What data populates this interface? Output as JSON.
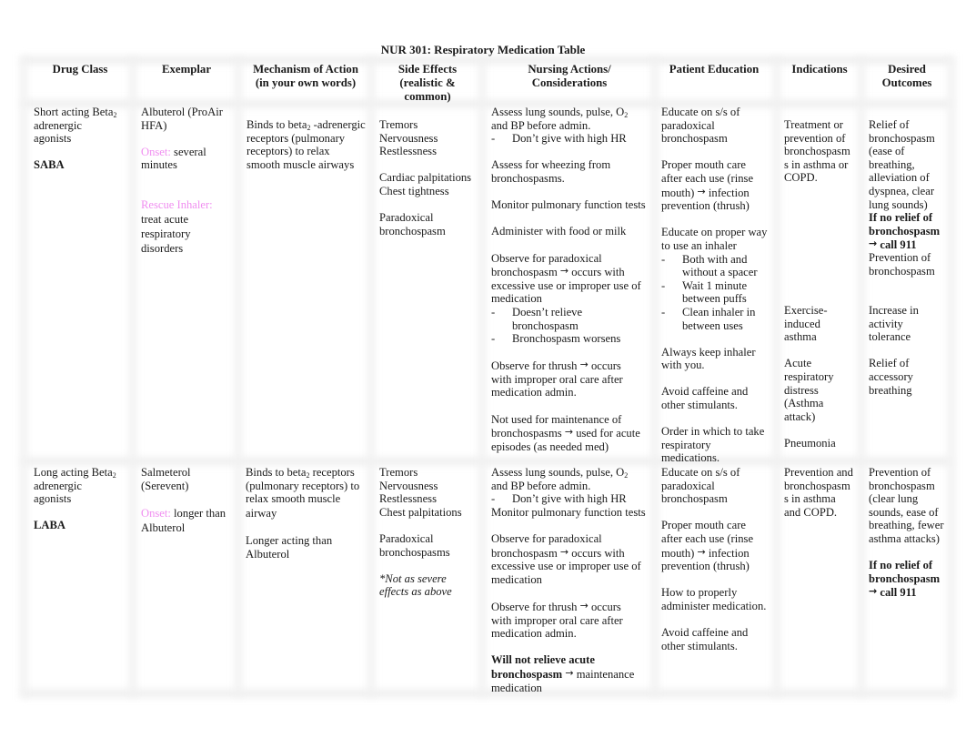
{
  "title": "NUR 301: Respiratory Medication Table",
  "headers": [
    "Drug Class",
    "Exemplar",
    "Mechanism of Action (in your own words)",
    "Side Effects (realistic & common)",
    "Nursing Actions/ Considerations",
    "Patient Education",
    "Indications",
    "Desired Outcomes"
  ],
  "header_lines": {
    "mechanism": [
      "Mechanism of Action",
      "(in your own words)"
    ],
    "side_effects": [
      "Side Effects",
      "(realistic &",
      "common)"
    ],
    "nursing": [
      "Nursing Actions/",
      "Considerations"
    ],
    "desired": [
      "Desired",
      "Outcomes"
    ]
  },
  "arrow_icon": "→",
  "colors": {
    "label_accent": "#f08ef0"
  },
  "rows": {
    "saba": {
      "drug_class": "Short acting Beta2 adrenergic agonists",
      "drug_class_lines": [
        "Short acting Beta",
        "adrenergic",
        "agonists"
      ],
      "abbrev": "SABA",
      "exemplar_lines": [
        "Albuterol (ProAir",
        "HFA)"
      ],
      "onset_label": "Onset:",
      "onset_value_lines": [
        "several",
        "minutes"
      ],
      "rescue_label": "Rescue Inhaler:",
      "rescue_lines": [
        "treat acute",
        "respiratory",
        "disorders"
      ],
      "mechanism_lines": [
        "Binds to beta",
        "-adrenergic",
        "receptors (pulmonary",
        "receptors) to relax",
        "smooth muscle airways"
      ],
      "side_effects_groups": [
        [
          "Tremors",
          "Nervousness",
          "Restlessness"
        ],
        [
          "Cardiac palpitations",
          "Chest tightness"
        ],
        [
          "Paradoxical",
          "bronchospasm"
        ]
      ],
      "nursing": {
        "assess1_lines": [
          "Assess lung sounds, pulse, O",
          "and BP before admin."
        ],
        "assess1_sub": "Don’t give with high HR",
        "wheeze_lines": [
          "Assess for wheezing from",
          "bronchospasms."
        ],
        "pft": "Monitor pulmonary function tests",
        "food": "Administer with food or milk",
        "paradox_lines": [
          "Observe for paradoxical",
          "bronchospasm",
          "occurs with",
          "excessive use or improper use of",
          "medication"
        ],
        "paradox_subs": [
          [
            "Doesn’t relieve",
            "bronchospasm"
          ],
          [
            "Bronchospasm worsens"
          ]
        ],
        "thrush_lines": [
          "Observe for thrush",
          "occurs",
          "with improper oral care after",
          "medication admin."
        ],
        "maint_lines": [
          "Not used for maintenance of",
          "bronchospasms",
          "used for acute",
          "episodes (as needed med)"
        ]
      },
      "education": {
        "ss_lines": [
          "Educate on s/s of",
          "paradoxical",
          "bronchospasm"
        ],
        "mouth_lines": [
          "Proper mouth care",
          "after each use (rinse",
          "mouth)",
          "infection",
          "prevention (thrush)"
        ],
        "inhaler_lines": [
          "Educate on proper way",
          "to use an inhaler"
        ],
        "inhaler_subs": [
          [
            "Both with and",
            "without a spacer"
          ],
          [
            "Wait 1 minute",
            "between puffs"
          ],
          [
            "Clean inhaler in",
            "between uses"
          ]
        ],
        "keep_lines": [
          "Always keep inhaler",
          "with you."
        ],
        "caffeine_lines": [
          "Avoid caffeine and",
          "other stimulants."
        ],
        "order_lines": [
          "Order in which to take",
          "respiratory",
          "medications."
        ]
      },
      "indications": {
        "treat_lines": [
          "Treatment or",
          "prevention of",
          "bronchospasm",
          "s in asthma or",
          "COPD."
        ],
        "exercise_lines": [
          "Exercise-",
          "induced",
          "asthma"
        ],
        "acute_lines": [
          "Acute",
          "respiratory",
          "distress",
          "(Asthma",
          "attack)"
        ],
        "pneumonia": "Pneumonia"
      },
      "outcomes": {
        "relief_lines": [
          "Relief of",
          "bronchospasm",
          "(ease of",
          "breathing,",
          "alleviation of",
          "dyspnea, clear",
          "lung sounds)"
        ],
        "call_lines": [
          "If no relief of",
          "bronchospasm",
          "call 911"
        ],
        "prevent_lines": [
          "Prevention of",
          "bronchospasm"
        ],
        "activity_lines": [
          "Increase in",
          "activity",
          "tolerance"
        ],
        "accessory_lines": [
          "Relief of",
          "accessory",
          "breathing"
        ]
      }
    },
    "laba": {
      "drug_class_lines": [
        "Long acting Beta",
        "adrenergic",
        "agonists"
      ],
      "abbrev": "LABA",
      "exemplar_lines": [
        "Salmeterol",
        "(Serevent)"
      ],
      "onset_label": "Onset:",
      "onset_value_lines": [
        "longer than",
        "Albuterol"
      ],
      "mechanism_lines": [
        " Binds to beta",
        "receptors",
        "(pulmonary receptors) to",
        "relax smooth muscle",
        "airway"
      ],
      "mechanism_extra_lines": [
        "Longer acting than",
        "Albuterol"
      ],
      "side_effects_lines": [
        "Tremors",
        "Nervousness",
        "Restlessness",
        "Chest palpitations"
      ],
      "side_effects_para_lines": [
        "Paradoxical",
        "bronchospasms"
      ],
      "side_effects_note_lines": [
        "*Not as severe",
        "effects as above"
      ],
      "nursing": {
        "assess1_lines": [
          "Assess lung sounds, pulse, O",
          "and BP before admin."
        ],
        "assess1_sub": "Don’t give with high HR",
        "pft": "Monitor pulmonary function tests",
        "paradox_lines": [
          "Observe for paradoxical",
          "bronchospasm",
          "occurs with",
          "excessive use or improper use of",
          "medication"
        ],
        "thrush_lines": [
          "Observe for thrush",
          "occurs",
          "with improper oral care after",
          "medication admin."
        ],
        "acute_bold_lines": [
          "Will not relieve acute",
          "bronchospasm"
        ],
        "acute_rest_lines": [
          "maintenance",
          "medication"
        ]
      },
      "education": {
        "ss_lines": [
          "Educate on s/s of",
          "paradoxical",
          "bronchospasm"
        ],
        "mouth_lines": [
          "Proper mouth care",
          "after each use (rinse",
          "mouth)",
          "infection",
          "prevention (thrush)"
        ],
        "admin_lines": [
          "How to properly",
          "administer medication."
        ],
        "caffeine_lines": [
          "Avoid caffeine and",
          "other stimulants."
        ]
      },
      "indications_lines": [
        "Prevention and",
        "bronchospasm",
        "s in asthma",
        "and COPD."
      ],
      "outcomes": {
        "prevent_lines": [
          "Prevention of",
          "bronchospasm",
          "(clear lung",
          "sounds, ease of",
          "breathing, fewer",
          "asthma attacks)"
        ],
        "call_lines": [
          "If no relief of",
          "bronchospasm",
          "call 911"
        ]
      }
    }
  }
}
